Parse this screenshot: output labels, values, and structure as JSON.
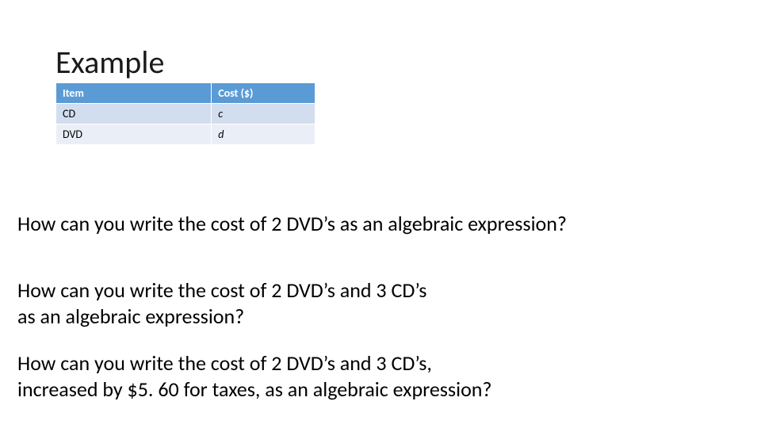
{
  "title": "Example",
  "table": {
    "headers": {
      "item": "Item",
      "cost": "Cost ($)"
    },
    "rows": [
      {
        "item": "CD",
        "cost": "c"
      },
      {
        "item": "DVD",
        "cost": "d"
      }
    ]
  },
  "questions": {
    "q1": "How can you write the cost of 2 DVD’s as an algebraic expression?",
    "q2_line1": "How can you write the cost of 2 DVD’s and 3 CD’s",
    "q2_line2": "as an algebraic expression?",
    "q3_line1": "How can you write the cost of 2 DVD’s and 3 CD’s,",
    "q3_line2": "increased by $5. 60 for taxes, as an algebraic expression?"
  }
}
